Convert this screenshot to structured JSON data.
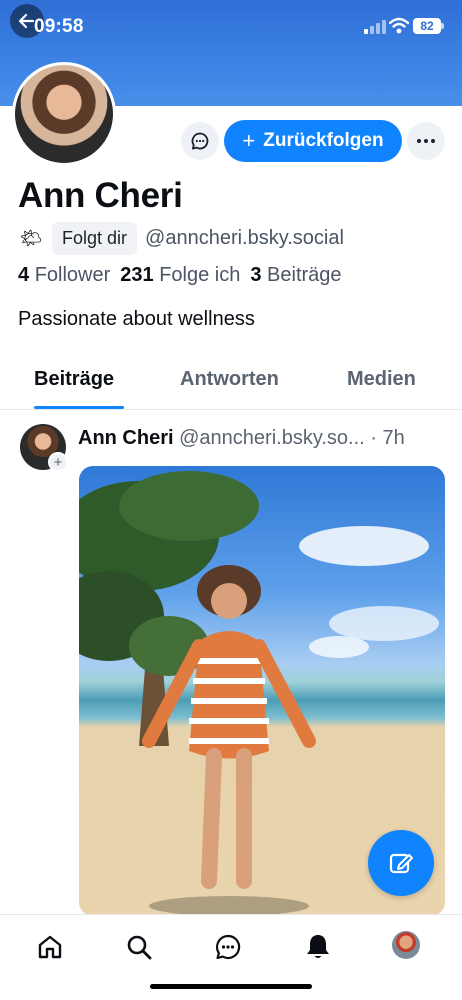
{
  "status_bar": {
    "time": "09:58",
    "battery": "82",
    "icons": [
      "back-arrow-icon",
      "signal-icon",
      "wifi-icon",
      "battery-icon"
    ]
  },
  "profile": {
    "display_name": "Ann Cheri",
    "status_emoji": "🌤",
    "follows_you_label": "Folgt dir",
    "handle": "@anncheri.bsky.social",
    "stats": {
      "followers_count": "4",
      "followers_label": "Follower",
      "following_count": "231",
      "following_label": "Folge ich",
      "posts_count": "3",
      "posts_label": "Beiträge"
    },
    "bio": "Passionate about wellness"
  },
  "actions": {
    "follow_back_label": "Zurückfolgen",
    "message_icon": "chat-bubble-icon",
    "more_icon": "ellipsis-icon"
  },
  "tabs": [
    {
      "label": "Beiträge",
      "active": true
    },
    {
      "label": "Antworten",
      "active": false
    },
    {
      "label": "Medien",
      "active": false
    }
  ],
  "post": {
    "author": "Ann Cheri",
    "handle": "@anncheri.bsky.so...",
    "time": "· 7h"
  },
  "bottom_nav": [
    "home-icon",
    "search-icon",
    "chat-icon",
    "bell-icon",
    "profile-avatar"
  ],
  "colors": {
    "accent": "#1083fe",
    "banner": "#3f86e6"
  }
}
